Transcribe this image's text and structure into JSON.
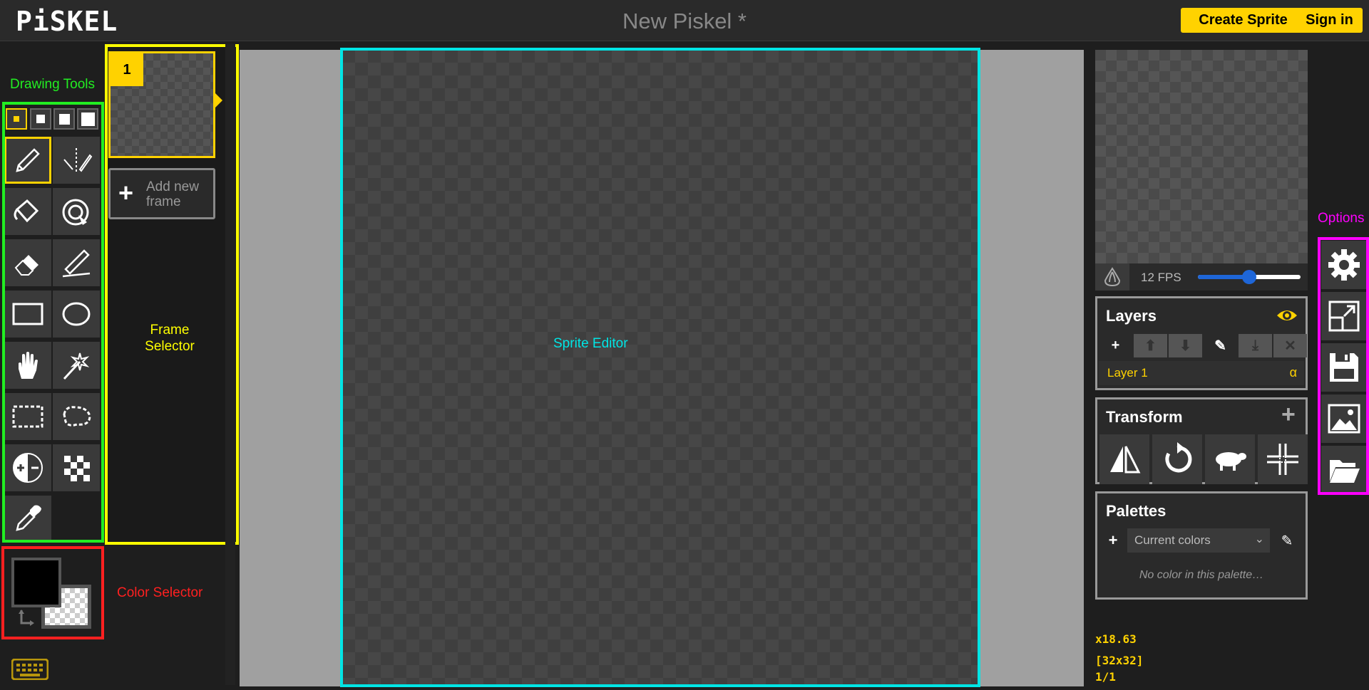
{
  "header": {
    "logo": "PiSKEL",
    "title": "New Piskel *",
    "create_sprite": "Create Sprite",
    "sign_in": "Sign in"
  },
  "annotations": {
    "drawing_tools": "Drawing Tools",
    "frame_selector": "Frame Selector",
    "sprite_editor": "Sprite Editor",
    "color_selector": "Color Selector",
    "options": "Options"
  },
  "tools": [
    "pencil-icon",
    "vertical-mirror-pen-icon",
    "paint-bucket-icon",
    "paint-all-same-color-icon",
    "eraser-icon",
    "stroke-icon",
    "rectangle-icon",
    "circle-icon",
    "move-hand-icon",
    "shape-selection-icon",
    "rectangle-selection-icon",
    "lasso-selection-icon",
    "lighten-darken-icon",
    "dithering-icon",
    "color-picker-icon"
  ],
  "frames": {
    "items": [
      {
        "number": "1"
      }
    ],
    "add_new_frame": "Add new frame"
  },
  "preview": {
    "fps_label": "12 FPS",
    "fps_value": 12
  },
  "layers": {
    "title": "Layers",
    "items": [
      {
        "name": "Layer 1",
        "alpha_label": "α"
      }
    ]
  },
  "transform": {
    "title": "Transform",
    "tools": [
      "flip-icon",
      "rotate-icon",
      "clone-sheep-icon",
      "center-icon"
    ]
  },
  "palettes": {
    "title": "Palettes",
    "selected": "Current colors",
    "empty_message": "No color in this palette…"
  },
  "status": {
    "zoom": "x18.63",
    "size": "[32x32]",
    "frame_counter": "1/1"
  },
  "colors": {
    "primary": "#000000",
    "accent": "#ffd200",
    "tools_outline": "#00ff00",
    "frames_outline": "#ffff00",
    "editor_outline": "#00ffff",
    "color_outline": "#ff0000",
    "options_outline": "#ff00ff"
  }
}
